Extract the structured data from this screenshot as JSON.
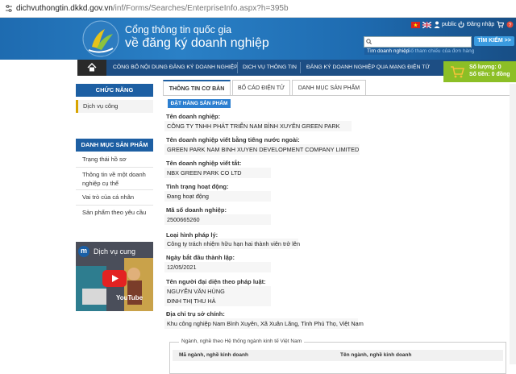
{
  "browser": {
    "url_host": "dichvuthongtin.dkkd.gov.vn",
    "url_path": "/inf/Forms/Searches/EnterpriseInfo.aspx?h=395b"
  },
  "header": {
    "title_line1": "Cổng thông tin quốc gia",
    "title_line2": "về đăng ký doanh nghiệp",
    "user_label": "public",
    "login_label": "Đăng nhập",
    "search_button": "TÌM KIẾM >>",
    "search_tab_active": "Tìm doanh nghiệp",
    "search_tab_other": "Số tham chiếu của đơn hàng"
  },
  "nav": {
    "items": [
      "CÔNG BỐ NỘI DUNG ĐĂNG KÝ DOANH NGHIỆP",
      "DỊCH VỤ THÔNG TIN",
      "ĐĂNG KÝ DOANH NGHIỆP QUA MẠNG ĐIỆN TỬ"
    ]
  },
  "cart": {
    "quantity": "Số lượng: 0",
    "amount": "Số tiền: 0 đồng"
  },
  "sidebar": {
    "section1_title": "CHỨC NĂNG",
    "section1_items": [
      "Dịch vụ công"
    ],
    "section2_title": "DANH MỤC SẢN PHẨM",
    "section2_items": [
      "Trạng thái hồ sơ",
      "Thông tin về một doanh nghiệp cụ thể",
      "Vai trò của cá nhân",
      "Sản phẩm theo yêu cầu"
    ],
    "video_title": "Dịch vụ cung",
    "video_channel_initial": "m",
    "video_platform": "YouTube"
  },
  "tabs": [
    "THÔNG TIN CƠ BẢN",
    "BỐ CÁO ĐIỆN TỬ",
    "DANH MỤC SẢN PHẨM"
  ],
  "order_button": "ĐẶT HÀNG SẢN PHẨM",
  "fields": {
    "name_label": "Tên doanh nghiệp:",
    "name_value": "CÔNG TY TNHH PHÁT TRIỂN NAM BÌNH XUYÊN GREEN PARK",
    "foreign_label": "Tên doanh nghiệp viết bằng tiếng nước ngoài:",
    "foreign_value": "GREEN PARK NAM BINH XUYEN DEVELOPMENT COMPANY LIMITED",
    "abbr_label": "Tên doanh nghiệp viết tắt:",
    "abbr_value": "NBX GREEN PARK CO LTD",
    "status_label": "Tình trạng hoạt động:",
    "status_value": "Đang hoạt động",
    "code_label": "Mã số doanh nghiệp:",
    "code_value": "2500665260",
    "type_label": "Loại hình pháp lý:",
    "type_value": "Công ty trách nhiệm hữu hạn hai thành viên trở lên",
    "date_label": "Ngày bắt đầu thành lập:",
    "date_value": "12/05/2021",
    "rep_label": "Tên người đại diện theo pháp luật:",
    "rep_value1": "NGUYỄN VĂN HÙNG",
    "rep_value2": "ĐINH THỊ THU HÀ",
    "address_label": "Địa chỉ trụ sở chính:",
    "address_value": "Khu công nghiệp Nam Bình Xuyên, Xã Xuân Lãng, Tỉnh Phú Thọ, Việt Nam"
  },
  "industry": {
    "legend": "Ngành, nghề theo Hệ thống ngành kinh tế Việt Nam",
    "col1": "Mã ngành, nghề kinh doanh",
    "col2": "Tên ngành, nghề kinh doanh"
  }
}
